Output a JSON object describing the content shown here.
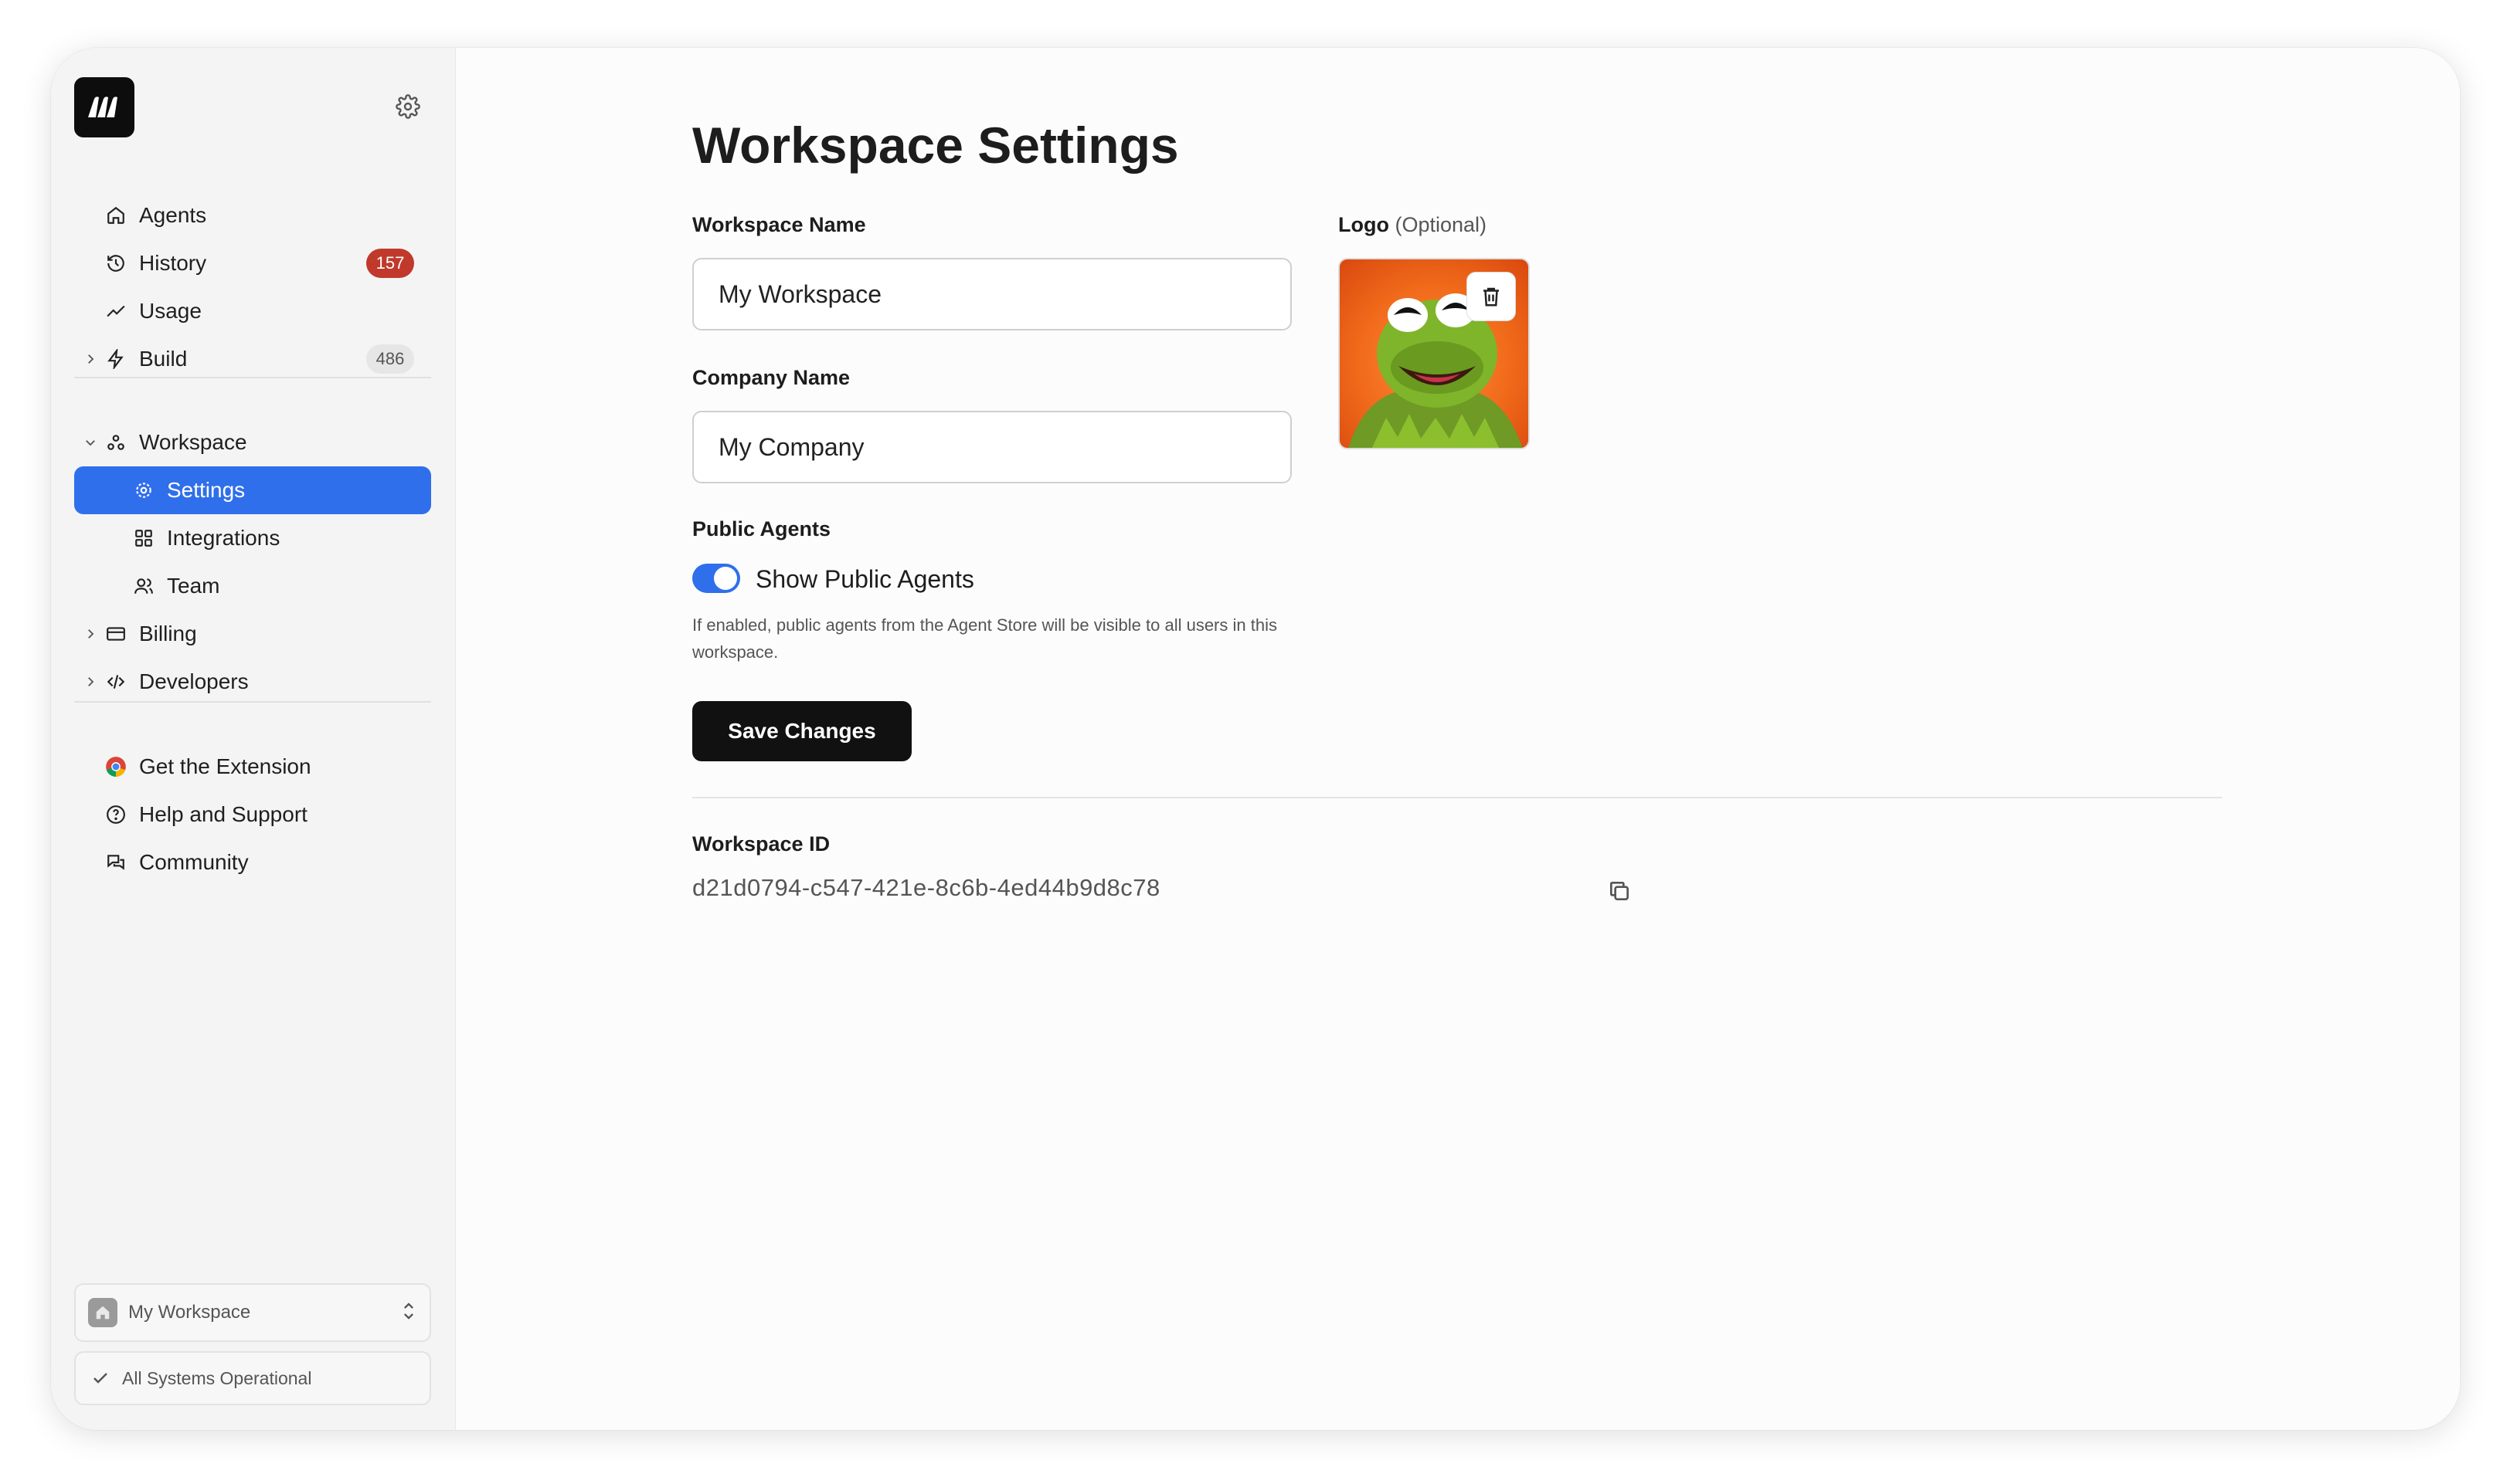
{
  "sidebar": {
    "primary": [
      {
        "label": "Agents",
        "icon": "home-icon"
      },
      {
        "label": "History",
        "icon": "history-icon",
        "badge": "157"
      },
      {
        "label": "Usage",
        "icon": "trend-icon"
      },
      {
        "label": "Build",
        "icon": "bolt-icon",
        "badge": "486"
      }
    ],
    "workspace": {
      "label": "Workspace",
      "children": [
        {
          "label": "Settings",
          "icon": "gear-icon"
        },
        {
          "label": "Integrations",
          "icon": "grid-icon"
        },
        {
          "label": "Team",
          "icon": "users-icon"
        }
      ]
    },
    "secondary": [
      {
        "label": "Billing",
        "icon": "card-icon"
      },
      {
        "label": "Developers",
        "icon": "code-icon"
      }
    ],
    "footer_links": [
      {
        "label": "Get the Extension",
        "icon": "chrome-icon"
      },
      {
        "label": "Help and Support",
        "icon": "help-icon"
      },
      {
        "label": "Community",
        "icon": "chat-icon"
      }
    ],
    "workspace_switcher": "My Workspace",
    "status": "All Systems Operational"
  },
  "main": {
    "title": "Workspace Settings",
    "workspace_name_label": "Workspace Name",
    "workspace_name_value": "My Workspace",
    "company_name_label": "Company Name",
    "company_name_value": "My Company",
    "logo_label": "Logo",
    "logo_optional": "(Optional)",
    "public_agents_label": "Public Agents",
    "public_agents_toggle_label": "Show Public Agents",
    "public_agents_enabled": true,
    "public_agents_help": "If enabled, public agents from the Agent Store will be visible to all users in this workspace.",
    "save_button": "Save Changes",
    "workspace_id_label": "Workspace ID",
    "workspace_id_value": "d21d0794-c547-421e-8c6b-4ed44b9d8c78"
  },
  "colors": {
    "accent": "#2f6feb",
    "badge_red": "#c0392b",
    "button_dark": "#111111"
  }
}
